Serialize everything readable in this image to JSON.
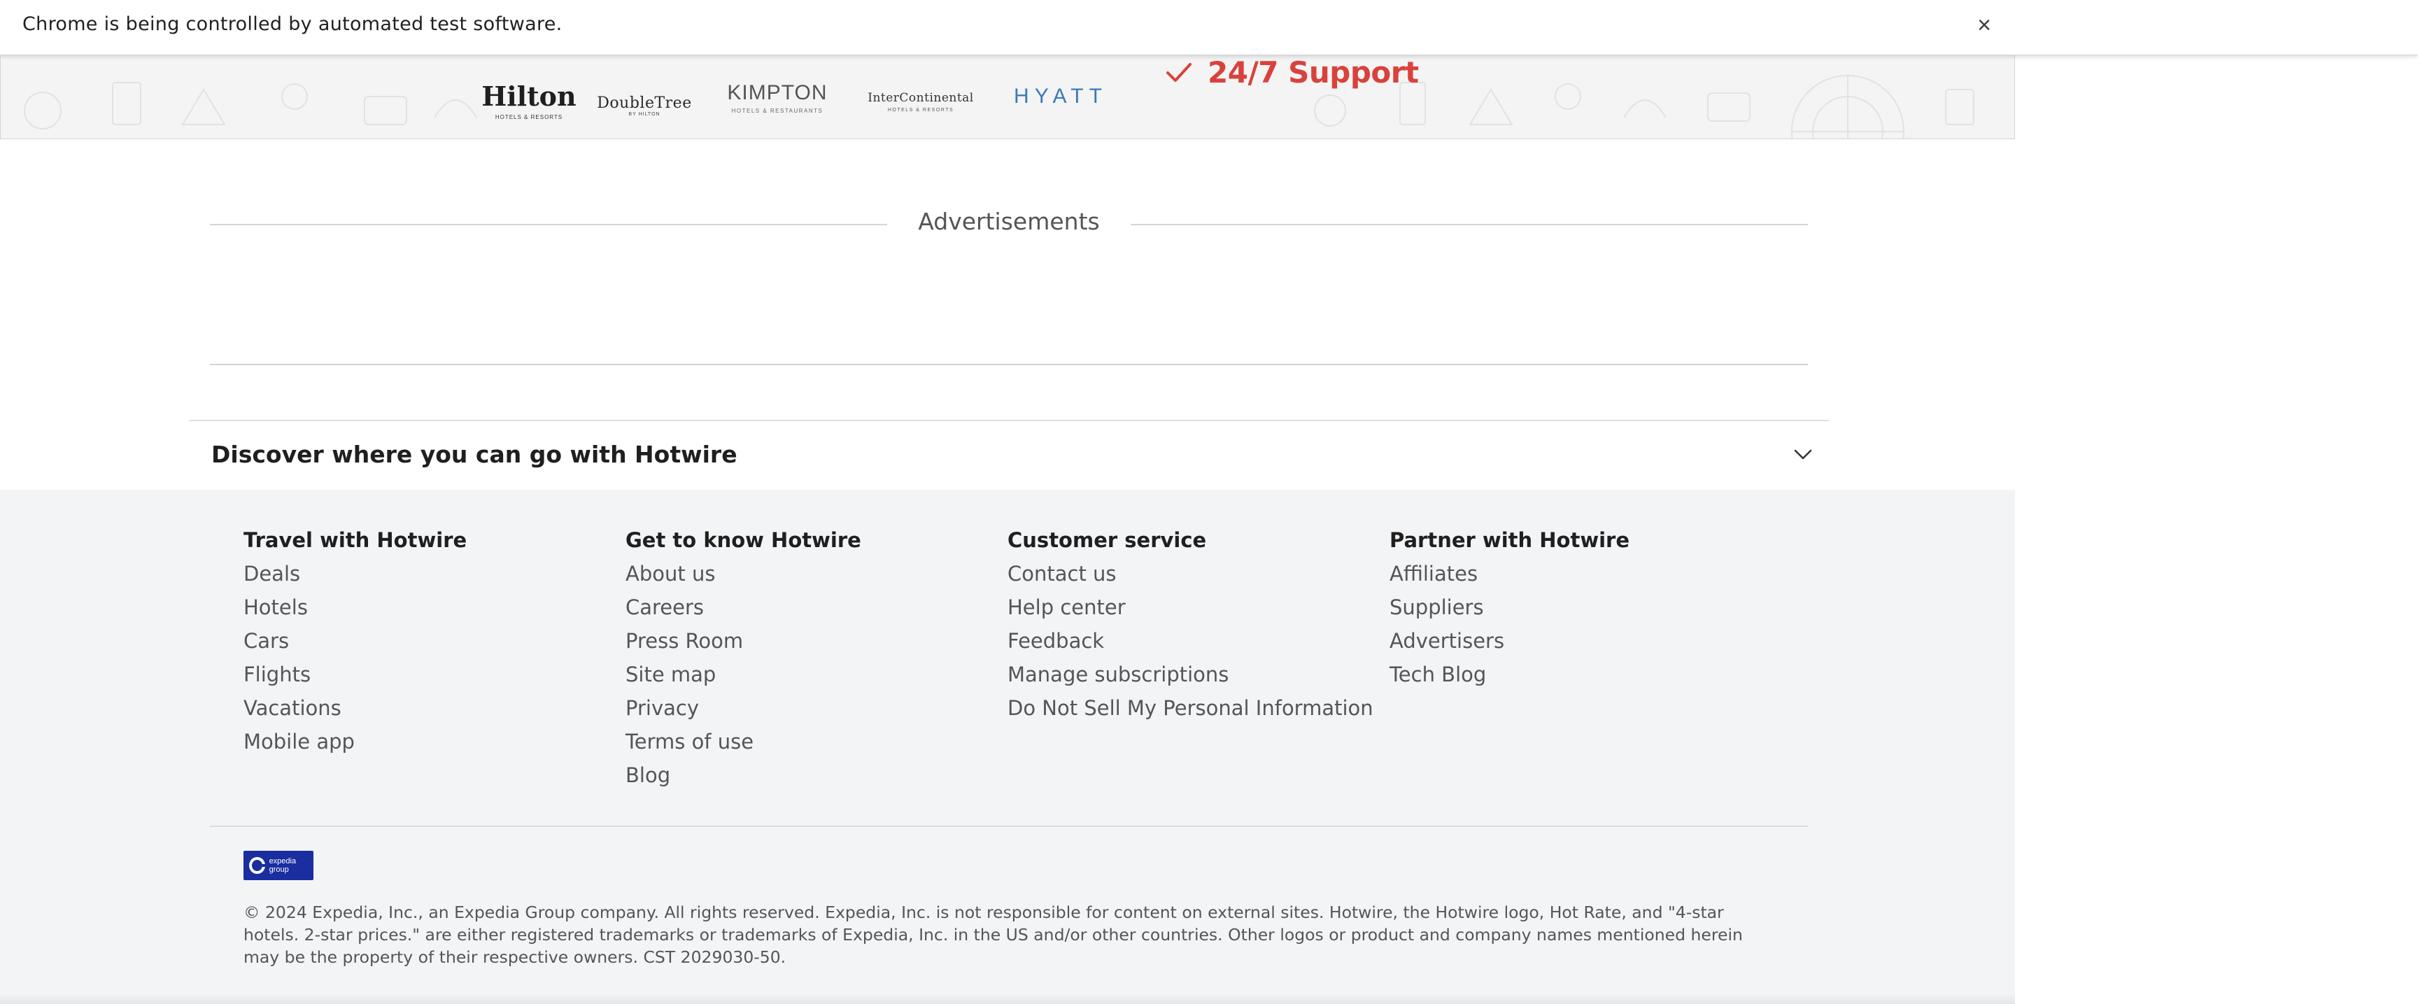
{
  "browser": {
    "infobar_text": "Chrome is being controlled by automated test software.",
    "close_glyph": "×"
  },
  "brands": {
    "hilton": {
      "name": "Hilton",
      "sub": "HOTELS & RESORTS"
    },
    "doubletree": {
      "name": "DoubleTree",
      "sub": "BY HILTON"
    },
    "kimpton": {
      "name": "KIMPTON",
      "sub": "HOTELS & RESTAURANTS"
    },
    "intercontinental": {
      "name": "InterContinental",
      "sub": "HOTELS & RESORTS"
    },
    "hyatt": {
      "name": "HYATT"
    },
    "support_text": "24/7 Support",
    "support_color": "#d9423c"
  },
  "ads": {
    "label": "Advertisements"
  },
  "discover": {
    "title": "Discover where you can go with Hotwire",
    "icon": "chevron-down-icon"
  },
  "footer": {
    "columns": [
      {
        "heading": "Travel with Hotwire",
        "links": [
          "Deals",
          "Hotels",
          "Cars",
          "Flights",
          "Vacations",
          "Mobile app"
        ]
      },
      {
        "heading": "Get to know Hotwire",
        "links": [
          "About us",
          "Careers",
          "Press Room",
          "Site map",
          "Privacy",
          "Terms of use",
          "Blog"
        ]
      },
      {
        "heading": "Customer service",
        "links": [
          "Contact us",
          "Help center",
          "Feedback",
          "Manage subscriptions",
          "Do Not Sell My Personal Information"
        ]
      },
      {
        "heading": "Partner with Hotwire",
        "links": [
          "Affiliates",
          "Suppliers",
          "Advertisers",
          "Tech Blog"
        ]
      }
    ],
    "expedia_badge": "expedia group",
    "badge_color": "#1a2ea0",
    "copyright": "© 2024 Expedia, Inc., an Expedia Group company. All rights reserved. Expedia, Inc. is not responsible for content on external sites. Hotwire, the Hotwire logo, Hot Rate, and \"4-star hotels. 2-star prices.\" are either registered trademarks or trademarks of Expedia, Inc. in the US and/or other countries. Other logos or product and company names mentioned herein may be the property of their respective owners. CST 2029030-50."
  }
}
